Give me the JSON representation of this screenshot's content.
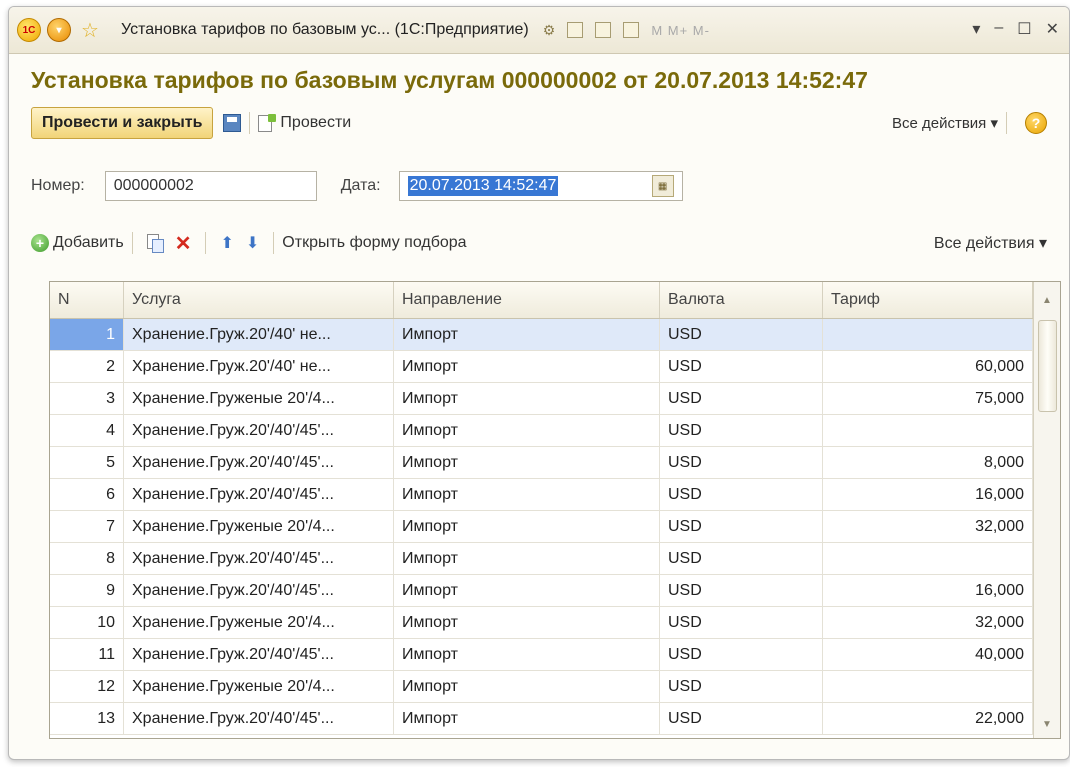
{
  "window": {
    "title": "Установка тарифов по базовым ус...  (1С:Предприятие)",
    "memory_buttons": "M  M+  M-",
    "logo_text": "1С"
  },
  "document": {
    "title": "Установка тарифов по базовым услугам 000000002 от 20.07.2013 14:52:47"
  },
  "toolbar": {
    "post_and_close": "Провести и закрыть",
    "post": "Провести",
    "all_actions": "Все действия ▾",
    "help": "?"
  },
  "fields": {
    "number_label": "Номер:",
    "number_value": "000000002",
    "date_label": "Дата:",
    "date_value": "20.07.2013 14:52:47"
  },
  "table_toolbar": {
    "add": "Добавить",
    "open_selection": "Открыть форму подбора",
    "all_actions": "Все действия ▾"
  },
  "table": {
    "columns": [
      "N",
      "Услуга",
      "Направление",
      "Валюта",
      "Тариф"
    ],
    "rows": [
      {
        "n": "1",
        "service": "Хранение.Груж.20'/40' не...",
        "direction": "Импорт",
        "currency": "USD",
        "tariff": ""
      },
      {
        "n": "2",
        "service": "Хранение.Груж.20'/40' не...",
        "direction": "Импорт",
        "currency": "USD",
        "tariff": "60,000"
      },
      {
        "n": "3",
        "service": "Хранение.Груженые 20'/4...",
        "direction": "Импорт",
        "currency": "USD",
        "tariff": "75,000"
      },
      {
        "n": "4",
        "service": "Хранение.Груж.20'/40'/45'...",
        "direction": "Импорт",
        "currency": "USD",
        "tariff": ""
      },
      {
        "n": "5",
        "service": "Хранение.Груж.20'/40'/45'...",
        "direction": "Импорт",
        "currency": "USD",
        "tariff": "8,000"
      },
      {
        "n": "6",
        "service": "Хранение.Груж.20'/40'/45'...",
        "direction": "Импорт",
        "currency": "USD",
        "tariff": "16,000"
      },
      {
        "n": "7",
        "service": "Хранение.Груженые 20'/4...",
        "direction": "Импорт",
        "currency": "USD",
        "tariff": "32,000"
      },
      {
        "n": "8",
        "service": "Хранение.Груж.20'/40'/45'...",
        "direction": "Импорт",
        "currency": "USD",
        "tariff": ""
      },
      {
        "n": "9",
        "service": "Хранение.Груж.20'/40'/45'...",
        "direction": "Импорт",
        "currency": "USD",
        "tariff": "16,000"
      },
      {
        "n": "10",
        "service": "Хранение.Груженые 20'/4...",
        "direction": "Импорт",
        "currency": "USD",
        "tariff": "32,000"
      },
      {
        "n": "11",
        "service": "Хранение.Груж.20'/40'/45'...",
        "direction": "Импорт",
        "currency": "USD",
        "tariff": "40,000"
      },
      {
        "n": "12",
        "service": "Хранение.Груженые 20'/4...",
        "direction": "Импорт",
        "currency": "USD",
        "tariff": ""
      },
      {
        "n": "13",
        "service": "Хранение.Груж.20'/40'/45'...",
        "direction": "Импорт",
        "currency": "USD",
        "tariff": "22,000"
      }
    ]
  }
}
